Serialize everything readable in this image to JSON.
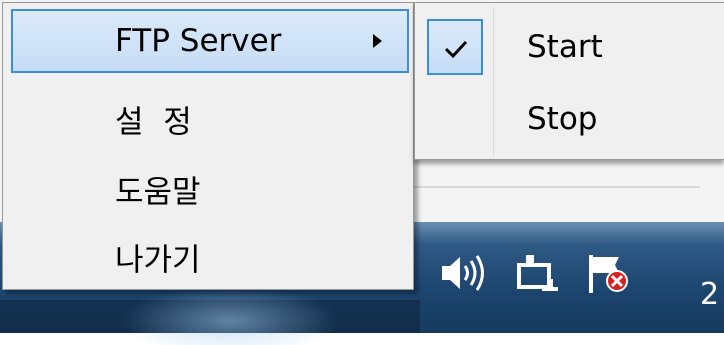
{
  "context_menu": {
    "items": [
      {
        "label": "FTP Server",
        "has_submenu": true,
        "highlighted": true
      },
      {
        "label": "설  정"
      },
      {
        "label": "도움말"
      },
      {
        "label": "나가기"
      }
    ]
  },
  "submenu": {
    "items": [
      {
        "label": "Start",
        "checked": true
      },
      {
        "label": "Stop",
        "checked": false
      }
    ]
  },
  "taskbar": {
    "tray_icons": [
      "speaker-icon",
      "network-icon",
      "action-center-flag-icon"
    ],
    "clock_text": "2"
  },
  "colors": {
    "menu_bg": "#f0f0f0",
    "highlight_border": "#3c8ed8",
    "highlight_fill": "#c6dcf5",
    "taskbar": "#1d4670"
  }
}
